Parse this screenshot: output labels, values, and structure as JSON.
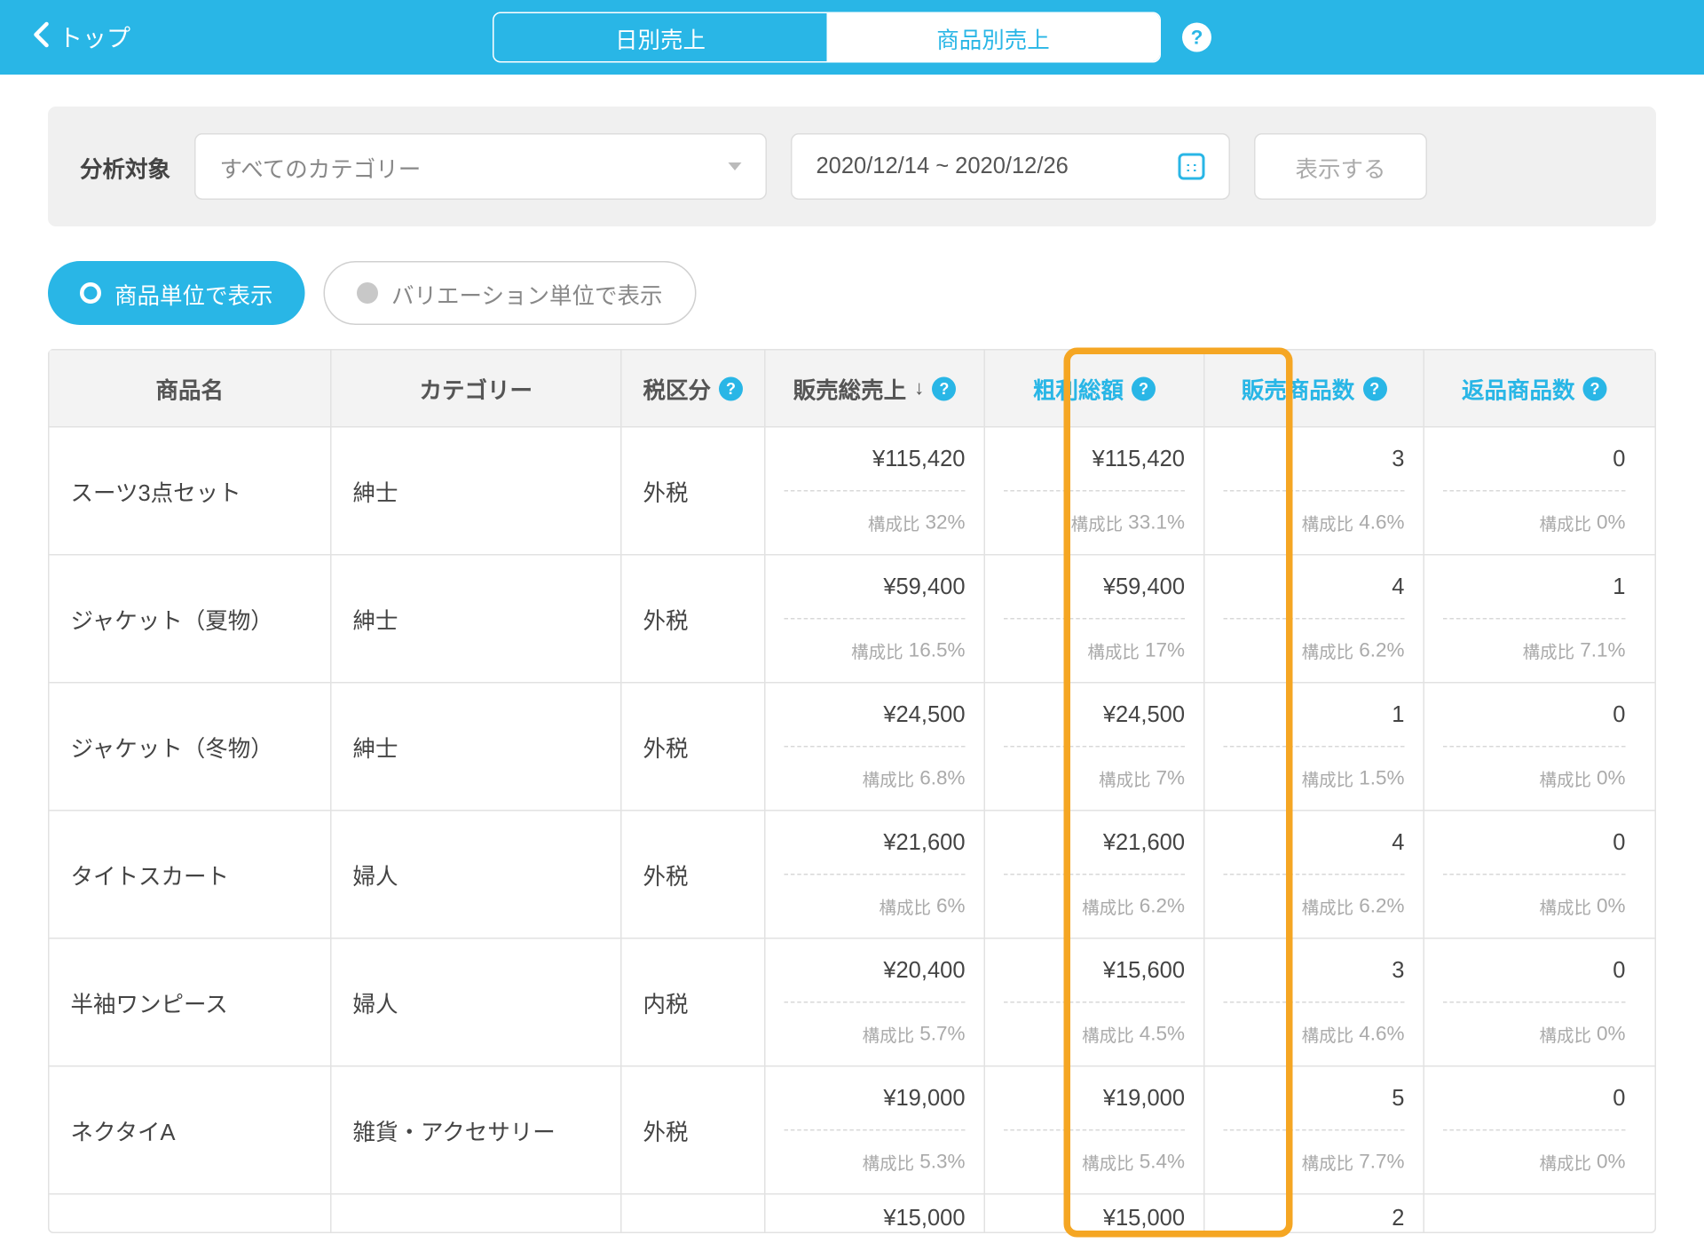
{
  "topbar": {
    "back_label": "トップ",
    "tab_daily": "日別売上",
    "tab_product": "商品別売上"
  },
  "filter": {
    "label": "分析対象",
    "category_placeholder": "すべてのカテゴリー",
    "date_range": "2020/12/14 ~ 2020/12/26",
    "apply": "表示する"
  },
  "mode": {
    "by_product": "商品単位で表示",
    "by_variation": "バリエーション単位で表示"
  },
  "columns": {
    "name": "商品名",
    "category": "カテゴリー",
    "tax": "税区分",
    "sales": "販売総売上",
    "gross": "粗利総額",
    "sold": "販売商品数",
    "returned": "返品商品数"
  },
  "ratio_prefix": "構成比",
  "rows": [
    {
      "name": "スーツ3点セット",
      "category": "紳士",
      "tax": "外税",
      "sales": "¥115,420",
      "sales_r": "32%",
      "gross": "¥115,420",
      "gross_r": "33.1%",
      "sold": "3",
      "sold_r": "4.6%",
      "returned": "0",
      "returned_r": "0%"
    },
    {
      "name": "ジャケット（夏物）",
      "category": "紳士",
      "tax": "外税",
      "sales": "¥59,400",
      "sales_r": "16.5%",
      "gross": "¥59,400",
      "gross_r": "17%",
      "sold": "4",
      "sold_r": "6.2%",
      "returned": "1",
      "returned_r": "7.1%"
    },
    {
      "name": "ジャケット（冬物）",
      "category": "紳士",
      "tax": "外税",
      "sales": "¥24,500",
      "sales_r": "6.8%",
      "gross": "¥24,500",
      "gross_r": "7%",
      "sold": "1",
      "sold_r": "1.5%",
      "returned": "0",
      "returned_r": "0%"
    },
    {
      "name": "タイトスカート",
      "category": "婦人",
      "tax": "外税",
      "sales": "¥21,600",
      "sales_r": "6%",
      "gross": "¥21,600",
      "gross_r": "6.2%",
      "sold": "4",
      "sold_r": "6.2%",
      "returned": "0",
      "returned_r": "0%"
    },
    {
      "name": "半袖ワンピース",
      "category": "婦人",
      "tax": "内税",
      "sales": "¥20,400",
      "sales_r": "5.7%",
      "gross": "¥15,600",
      "gross_r": "4.5%",
      "sold": "3",
      "sold_r": "4.6%",
      "returned": "0",
      "returned_r": "0%"
    },
    {
      "name": "ネクタイA",
      "category": "雑貨・アクセサリー",
      "tax": "外税",
      "sales": "¥19,000",
      "sales_r": "5.3%",
      "gross": "¥19,000",
      "gross_r": "5.4%",
      "sold": "5",
      "sold_r": "7.7%",
      "returned": "0",
      "returned_r": "0%"
    },
    {
      "name": "",
      "category": "",
      "tax": "",
      "sales": "¥15,000",
      "sales_r": "",
      "gross": "¥15,000",
      "gross_r": "",
      "sold": "2",
      "sold_r": "",
      "returned": "",
      "returned_r": ""
    }
  ]
}
